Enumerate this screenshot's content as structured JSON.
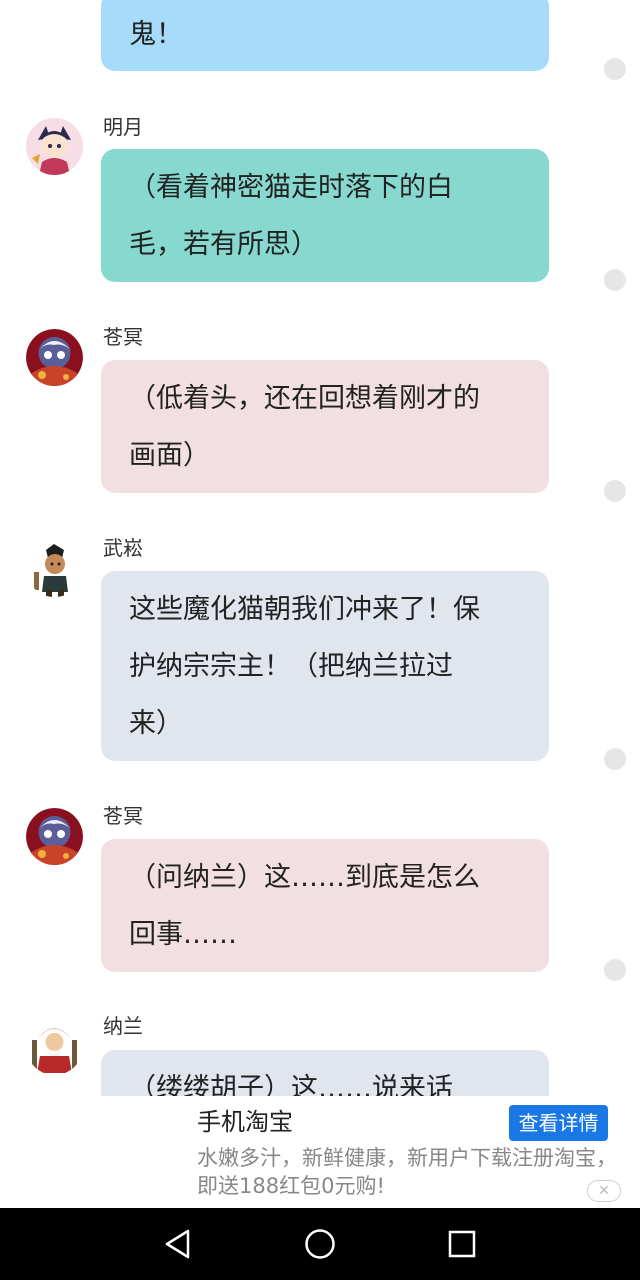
{
  "messages": [
    {
      "sender": "",
      "text": "鬼！",
      "color": "#a6dbfa"
    },
    {
      "sender": "明月",
      "text": "（看着神密猫走时落下的白\n毛，若有所思）",
      "color": "#87d9d0"
    },
    {
      "sender": "苍冥",
      "text": "（低着头，还在回想着刚才的\n画面）",
      "color": "#f1dfe1"
    },
    {
      "sender": "武崧",
      "text": "这些魔化猫朝我们冲来了！保\n护纳宗宗主！（把纳兰拉过\n来）",
      "color": "#e1e6ee"
    },
    {
      "sender": "苍冥",
      "text": "（问纳兰）这……到底是怎么\n回事……",
      "color": "#f1dfe1"
    },
    {
      "sender": "纳兰",
      "text": "（缕缕胡子）这……说来话",
      "color": "#e1e6ee"
    }
  ],
  "ad": {
    "title": "手机淘宝",
    "button_label": "查看详情",
    "description": "水嫩多汁，新鲜健康，新用户下载注册淘宝，即送188红包0元购!",
    "close_icon": "close-icon"
  },
  "navbar": {
    "back_icon": "triangle-back-icon",
    "home_icon": "circle-home-icon",
    "recents_icon": "square-recents-icon"
  }
}
